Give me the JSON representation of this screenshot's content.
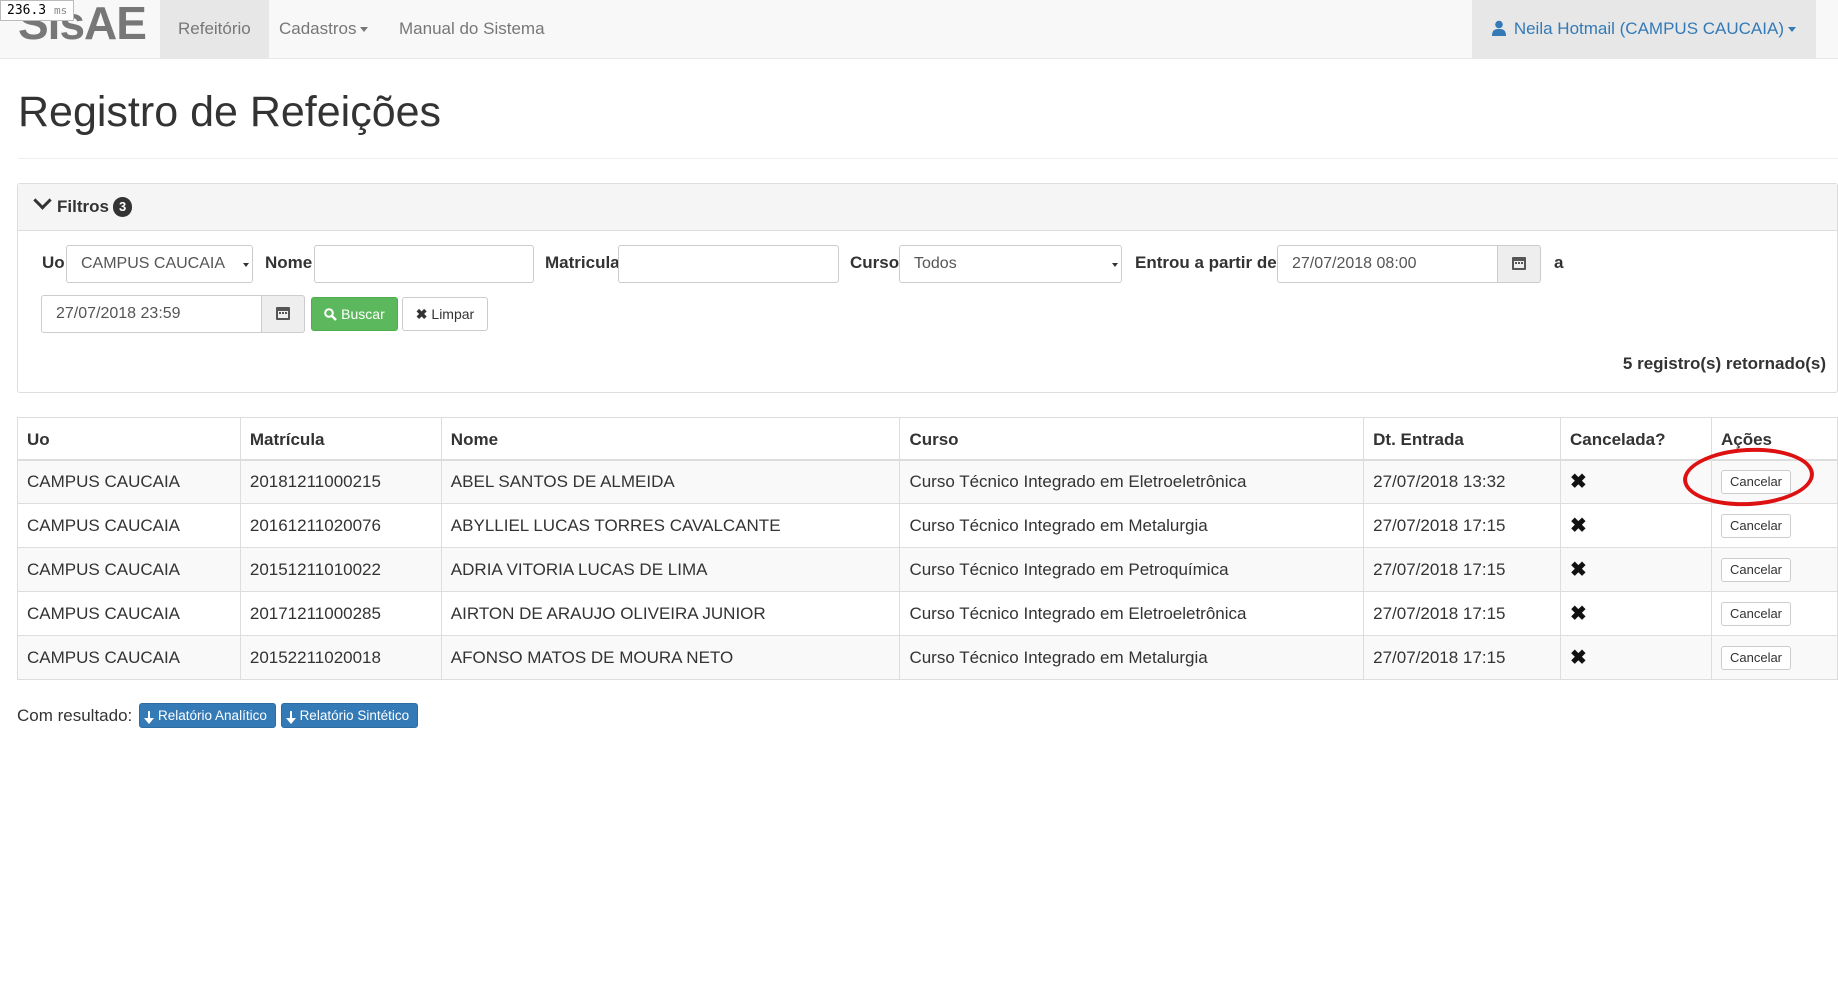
{
  "perf": {
    "value": "236.3",
    "unit": "ms"
  },
  "nav": {
    "brand": "SisAE",
    "items": [
      "Refeitório",
      "Cadastros",
      "Manual do Sistema"
    ],
    "user": "Neila Hotmail (CAMPUS CAUCAIA)"
  },
  "page": {
    "title": "Registro de Refeições"
  },
  "filters": {
    "title": "Filtros",
    "badge": "3",
    "uo_label": "Uo",
    "uo_value": "CAMPUS CAUCAIA",
    "nome_label": "Nome",
    "nome_value": "",
    "matricula_label": "Matricula",
    "matricula_value": "",
    "curso_label": "Curso",
    "curso_value": "Todos",
    "entrou_label": "Entrou a partir de",
    "date_from": "27/07/2018 08:00",
    "a_label": "a",
    "date_to": "27/07/2018 23:59",
    "buscar_label": "Buscar",
    "limpar_label": "Limpar",
    "results_text": "5 registro(s) retornado(s)"
  },
  "table": {
    "headers": [
      "Uo",
      "Matrícula",
      "Nome",
      "Curso",
      "Dt. Entrada",
      "Cancelada?",
      "Ações"
    ],
    "rows": [
      {
        "uo": "CAMPUS CAUCAIA",
        "matricula": "20181211000215",
        "nome": "ABEL SANTOS DE ALMEIDA",
        "curso": "Curso Técnico Integrado em Eletroeletrônica",
        "entrada": "27/07/2018 13:32",
        "cancelada": "✖",
        "acao": "Cancelar"
      },
      {
        "uo": "CAMPUS CAUCAIA",
        "matricula": "20161211020076",
        "nome": "ABYLLIEL LUCAS TORRES CAVALCANTE",
        "curso": "Curso Técnico Integrado em Metalurgia",
        "entrada": "27/07/2018 17:15",
        "cancelada": "✖",
        "acao": "Cancelar"
      },
      {
        "uo": "CAMPUS CAUCAIA",
        "matricula": "20151211010022",
        "nome": "ADRIA VITORIA LUCAS DE LIMA",
        "curso": "Curso Técnico Integrado em Petroquímica",
        "entrada": "27/07/2018 17:15",
        "cancelada": "✖",
        "acao": "Cancelar"
      },
      {
        "uo": "CAMPUS CAUCAIA",
        "matricula": "20171211000285",
        "nome": "AIRTON DE ARAUJO OLIVEIRA JUNIOR",
        "curso": "Curso Técnico Integrado em Eletroeletrônica",
        "entrada": "27/07/2018 17:15",
        "cancelada": "✖",
        "acao": "Cancelar"
      },
      {
        "uo": "CAMPUS CAUCAIA",
        "matricula": "20152211020018",
        "nome": "AFONSO MATOS DE MOURA NETO",
        "curso": "Curso Técnico Integrado em Metalurgia",
        "entrada": "27/07/2018 17:15",
        "cancelada": "✖",
        "acao": "Cancelar"
      }
    ]
  },
  "footer": {
    "label": "Com resultado:",
    "btn_analitico": "Relatório Analítico",
    "btn_sintetico": "Relatório Sintético"
  },
  "colors": {
    "primary": "#337ab7",
    "success": "#5cb85c",
    "annotation": "#dd1111"
  }
}
